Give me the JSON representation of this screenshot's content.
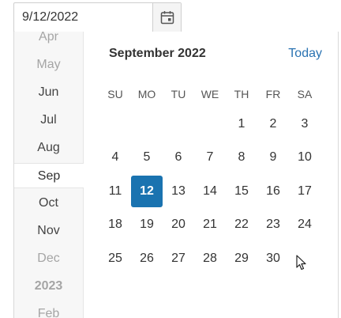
{
  "date_input": {
    "value": "9/12/2022",
    "button_icon": "calendar-icon"
  },
  "month_strip": {
    "items": [
      {
        "label": "Apr",
        "style": "faded"
      },
      {
        "label": "May",
        "style": "faded"
      },
      {
        "label": "Jun",
        "style": "normal"
      },
      {
        "label": "Jul",
        "style": "normal"
      },
      {
        "label": "Aug",
        "style": "normal"
      },
      {
        "label": "Sep",
        "style": "selected"
      },
      {
        "label": "Oct",
        "style": "normal"
      },
      {
        "label": "Nov",
        "style": "normal"
      },
      {
        "label": "Dec",
        "style": "faded"
      },
      {
        "label": "2023",
        "style": "year"
      },
      {
        "label": "Feb",
        "style": "faded"
      }
    ]
  },
  "calendar": {
    "title": "September 2022",
    "today_label": "Today",
    "weekdays": [
      "SU",
      "MO",
      "TU",
      "WE",
      "TH",
      "FR",
      "SA"
    ],
    "weeks": [
      [
        "",
        "",
        "",
        "",
        "1",
        "2",
        "3"
      ],
      [
        "4",
        "5",
        "6",
        "7",
        "8",
        "9",
        "10"
      ],
      [
        "11",
        "12",
        "13",
        "14",
        "15",
        "16",
        "17"
      ],
      [
        "18",
        "19",
        "20",
        "21",
        "22",
        "23",
        "24"
      ],
      [
        "25",
        "26",
        "27",
        "28",
        "29",
        "30",
        ""
      ]
    ],
    "selected_day": "12"
  },
  "colors": {
    "accent": "#1a73b0",
    "link": "#2a73b2"
  }
}
